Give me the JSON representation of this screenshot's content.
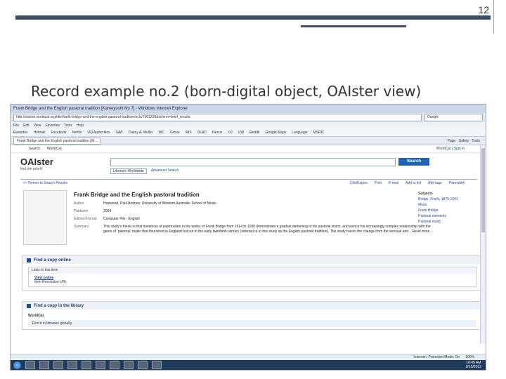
{
  "slide": {
    "number": "12",
    "title": "Record example no.2 (born-digital object, OAIster view)"
  },
  "browser": {
    "window_title": "Frank Bridge and the English pastoral tradition [Kameyoshi No 7] - Windows Internet Explorer",
    "address": "http://oaister.worldcat.org/title/frank-bridge-and-the-english-pastoral-tradition/oclc/7301336&referer=brief_results",
    "search_engine": "Google",
    "menu": [
      "File",
      "Edit",
      "View",
      "Favorites",
      "Tools",
      "Help"
    ],
    "favorites": [
      "Favorites",
      "Hotmail",
      "Facebook",
      "Netflix",
      "UQ Authorities",
      "SAP",
      "Casey A. Muller",
      "WC",
      "Grove",
      "IMS",
      "OLAC",
      "Nexus",
      "OJ",
      "UW",
      "Reddit",
      "Google Maps",
      "Language",
      "MSRIC"
    ],
    "tab_label": "Frank Bridge and the English pastoral tradition [W...",
    "tab_tools": [
      "Page",
      "Safety",
      "Tools"
    ],
    "status_text": "Internet | Protected Mode: On",
    "zoom": "100%"
  },
  "page": {
    "top_links": [
      "Search",
      "WorldCat"
    ],
    "sign_in": "WorldCat | Sign in",
    "logo": "OAIster",
    "logo_tag": "find the pearls",
    "search_placeholder": "",
    "search_button": "Search",
    "library_label": "Libraries Worldwide",
    "advanced_search": "Advanced Search",
    "back_link": "<< Return to Search Results",
    "actions": [
      "Cite/Export",
      "Print",
      "E-mail",
      "Add to list",
      "Add tags",
      "Permalink"
    ],
    "record_title": "Frank Bridge and the English pastoral tradition",
    "fields": [
      {
        "key": "Author",
        "value": "Hopwood, Paul Andrew; University of Western Australia. School of Music"
      },
      {
        "key": "Publisher",
        "value": "2009"
      },
      {
        "key": "Edition/Format",
        "value": "Computer File : English"
      },
      {
        "key": "Summary",
        "value": "This study's thesis is that instances of pastoralism in the works of Frank Bridge from 1914 to 1930 demonstrate a gradual darkening of his pastoral vision, and evince his increasingly complex relationship with the genre of 'pastoral' music that flourished in England but not in the early twentieth century (referred to in this study as the English pastoral tradition). The study traces the change from the sensual and... Read more..."
      }
    ],
    "subjects_heading": "Subjects",
    "subjects": [
      "Bridge, Frank, 1879-1941",
      "Music",
      "Frank Bridge",
      "Pastoral elements",
      "Pastoral music"
    ],
    "section_online": "Find a copy online",
    "links_heading": "Links to this item",
    "view_online": "View online",
    "item_resolution": "Item Resolution URL",
    "section_library": "Find a copy in the library",
    "worldcat_label": "WorldCat",
    "find_libraries": "Find it in libraries globally"
  },
  "taskbar": {
    "time": "10:45 AM",
    "date": "2/15/2012"
  }
}
